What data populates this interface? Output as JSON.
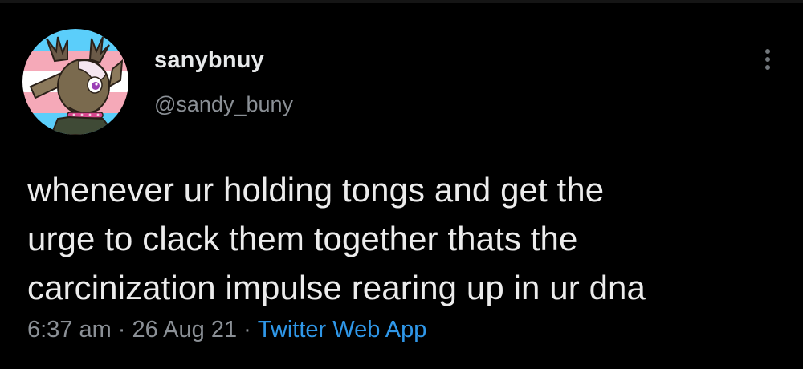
{
  "tweet": {
    "author": {
      "display_name": "sanybnuy",
      "handle": "@sandy_buny",
      "avatar_icon": "character-avatar-icon"
    },
    "text_lines": [
      "whenever ur holding tongs and get the",
      "urge to clack them together thats the",
      "carcinization impulse rearing up in ur dna"
    ],
    "time": "6:37 am",
    "separator": "·",
    "date": "26 Aug 21",
    "source": "Twitter Web App"
  },
  "colors": {
    "background": "#000000",
    "text": "#e7e9ea",
    "secondary": "#8b9096",
    "link": "#2f97e8",
    "avatar_stripes": [
      "#5bcefa",
      "#f5a9b8",
      "#ffffff",
      "#f5a9b8",
      "#5bcefa"
    ]
  }
}
